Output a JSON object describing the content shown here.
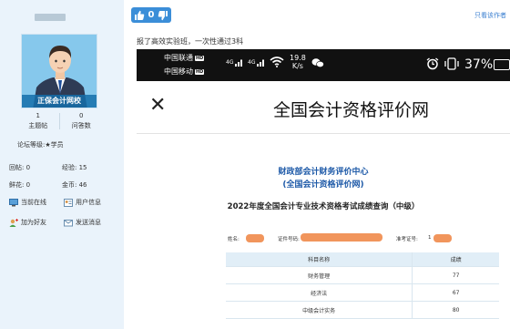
{
  "sidebar": {
    "avatar_banner": "正保会计网校",
    "stats": [
      {
        "value": "1",
        "label": "主题帖"
      },
      {
        "value": "0",
        "label": "问答数"
      }
    ],
    "level_label": "论坛等级:",
    "level_value": "★学员",
    "info": [
      {
        "label": "回帖:",
        "value": "0"
      },
      {
        "label": "经验:",
        "value": "15"
      },
      {
        "label": "鲜花:",
        "value": "0"
      },
      {
        "label": "金币:",
        "value": "46"
      }
    ],
    "actions": [
      {
        "label": "当前在线",
        "icon": "monitor-icon"
      },
      {
        "label": "用户信息",
        "icon": "user-card-icon"
      },
      {
        "label": "加为好友",
        "icon": "add-friend-icon"
      },
      {
        "label": "发送消息",
        "icon": "message-icon"
      }
    ]
  },
  "post": {
    "like_count": "0",
    "author_only": "只看该作者",
    "text": "报了高效实验班，一次性通过3科"
  },
  "screenshot": {
    "status": {
      "carrier1": "中国联通",
      "carrier2": "中国移动",
      "hd": "HD",
      "sig1": "4G",
      "sig2": "4G",
      "speed": "19.8",
      "speed_unit": "K/s",
      "battery": "37%"
    },
    "app_title": "全国会计资格评价网",
    "center_line1": "财政部会计财务评价中心",
    "center_line2": "(全国会计资格评价网)",
    "report_title": "2022年度全国会计专业技术资格考试成绩查询（中级）",
    "fields": {
      "name": "姓名:",
      "id": "证件号码:",
      "exam_no": "准考证号:",
      "exam_no_partial": "1"
    },
    "table": {
      "headers": [
        "科目名称",
        "成绩"
      ],
      "rows": [
        [
          "财务管理",
          "77"
        ],
        [
          "经济法",
          "67"
        ],
        [
          "中级会计实务",
          "80"
        ]
      ]
    }
  },
  "colors": {
    "sidebar_bg": "#eaf3fb",
    "like_blue": "#3b8ed8",
    "link_blue": "#3a7fd0",
    "center_blue": "#1e5aa8",
    "table_head": "#e1eef7"
  }
}
